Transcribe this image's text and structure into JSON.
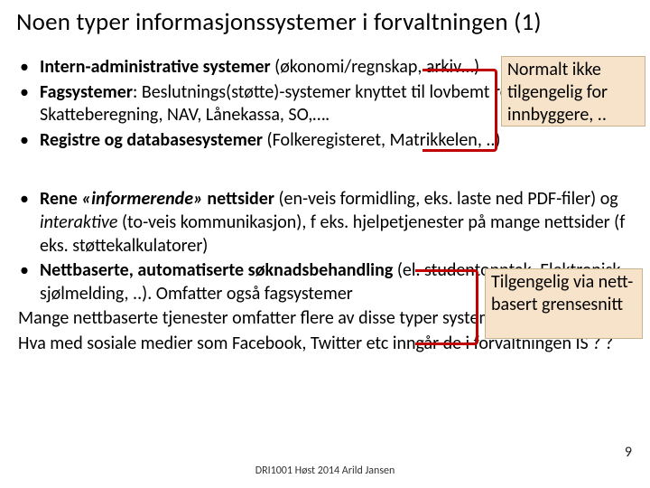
{
  "title": "Noen typer informasjonssystemer i forvaltningen (1)",
  "bullets_top": [
    {
      "bold": "Intern-administrative systemer ",
      "rest": "(økonomi/regnskap, arkiv…)"
    },
    {
      "bold": "Fagsystemer",
      "rest": ": Beslutnings(støtte)-systemer knyttet til lovbemt regelverk, f eks. Skatteberegning, NAV, Lånekassa, SO,…."
    },
    {
      "bold": "Registre og databasesystemer ",
      "rest": "(Folkeregisteret, Matrikkelen, ..)"
    }
  ],
  "bullets_bottom": [
    {
      "pre": "Rene ",
      "italic1": "«informerende»",
      "mid1": " nettsider ",
      "rest1": "(en-veis formidling, eks. laste ned PDF-filer) og ",
      "italic2": "interaktive ",
      "rest2": "(to-veis kommunikasjon), f eks. hjelpetjenester på mange nettsider (f eks. støttekalkulatorer)"
    },
    {
      "bold": "Nettbaserte, automatiserte søknadsbehandling ",
      "rest": "(el. studentopptak, Elektronisk. sjølmelding, ..). Omfatter også fagsystemer"
    }
  ],
  "plain_lines": [
    "Mange nettbaserte tjenester omfatter flere av disse typer systemer",
    "Hva med sosiale medier som Facebook, Twitter etc inngår de i forvaltningen  IS ? ?"
  ],
  "callout1": "Normalt ikke tilgengelig for innbyggere, ..",
  "callout2": "Tilgengelig via nett-basert grensesnitt",
  "footer": "DRI1001 Høst 2014  Arild Jansen",
  "page_num": "9"
}
